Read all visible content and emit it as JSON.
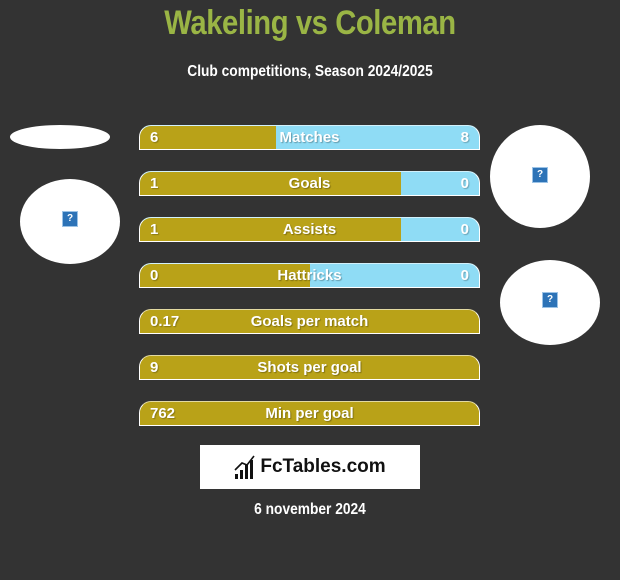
{
  "header": {
    "title": "Wakeling vs Coleman",
    "subtitle": "Club competitions, Season 2024/2025"
  },
  "colors": {
    "background": "#333333",
    "title": "#9ab545",
    "left_bar": "#b9a218",
    "right_bar": "#8fdcf5"
  },
  "stats": [
    {
      "label": "Matches",
      "left": "6",
      "right": "8",
      "left_share": 0.4
    },
    {
      "label": "Goals",
      "left": "1",
      "right": "0",
      "left_share": 0.77
    },
    {
      "label": "Assists",
      "left": "1",
      "right": "0",
      "left_share": 0.77
    },
    {
      "label": "Hattricks",
      "left": "0",
      "right": "0",
      "left_share": 0.5
    },
    {
      "label": "Goals per match",
      "left": "0.17",
      "right": null,
      "left_share": 1.0
    },
    {
      "label": "Shots per goal",
      "left": "9",
      "right": null,
      "left_share": 1.0
    },
    {
      "label": "Min per goal",
      "left": "762",
      "right": null,
      "left_share": 1.0
    }
  ],
  "images": {
    "unknown_icon": "?"
  },
  "footer": {
    "logo_text": "FcTables.com",
    "date": "6 november 2024"
  }
}
